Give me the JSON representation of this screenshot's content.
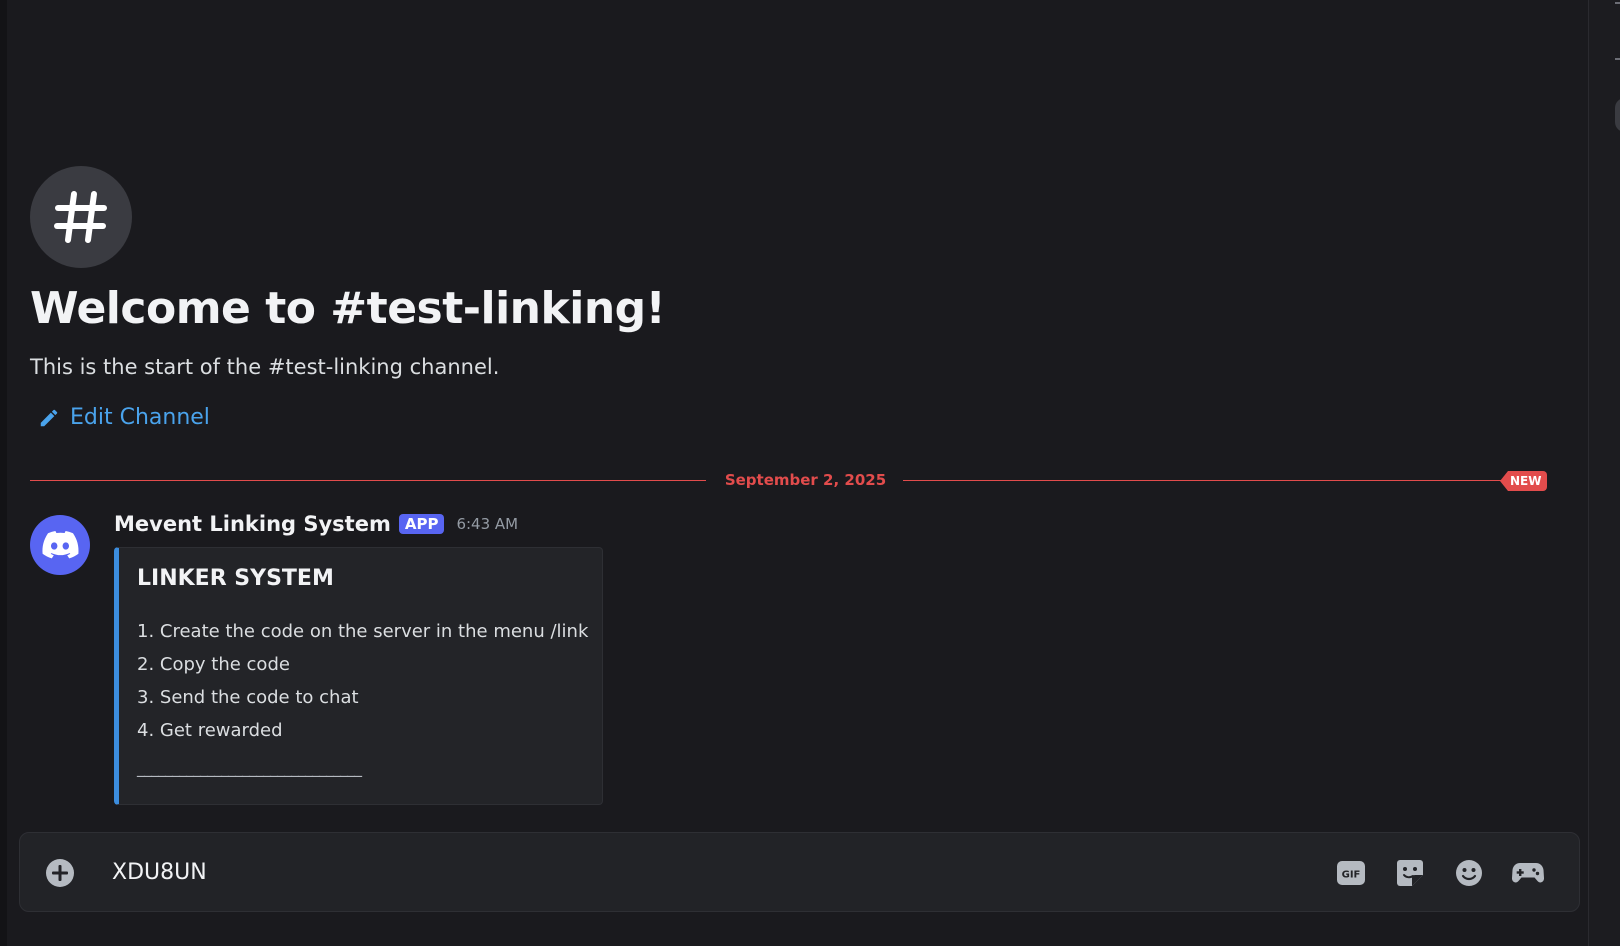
{
  "colors": {
    "background": "#1a1a1e",
    "accent": "#5865f2",
    "link": "#4aa3ec",
    "new_divider": "#e24c4c",
    "embed_bar": "#3c8dde"
  },
  "channel": {
    "icon": "hashtag-icon",
    "welcome_title": "Welcome to #test-linking!",
    "description": "This is the start of the #test-linking channel.",
    "edit_label": "Edit Channel"
  },
  "divider": {
    "date": "September 2, 2025",
    "new_label": "NEW"
  },
  "message": {
    "author": "Mevent Linking System",
    "tag": "APP",
    "time": "6:43 AM",
    "avatar_icon": "discord-logo-icon",
    "embed": {
      "title": "LINKER SYSTEM",
      "lines": [
        "1. Create the code on the server in the menu /link",
        "2. Copy the code",
        "3. Send the code to chat",
        "4. Get rewarded"
      ],
      "footer": "________________________________"
    }
  },
  "composer": {
    "value": "XDU8UN",
    "tools": [
      "add-attachment-icon",
      "gif-icon",
      "sticker-icon",
      "emoji-icon",
      "activities-icon"
    ]
  }
}
